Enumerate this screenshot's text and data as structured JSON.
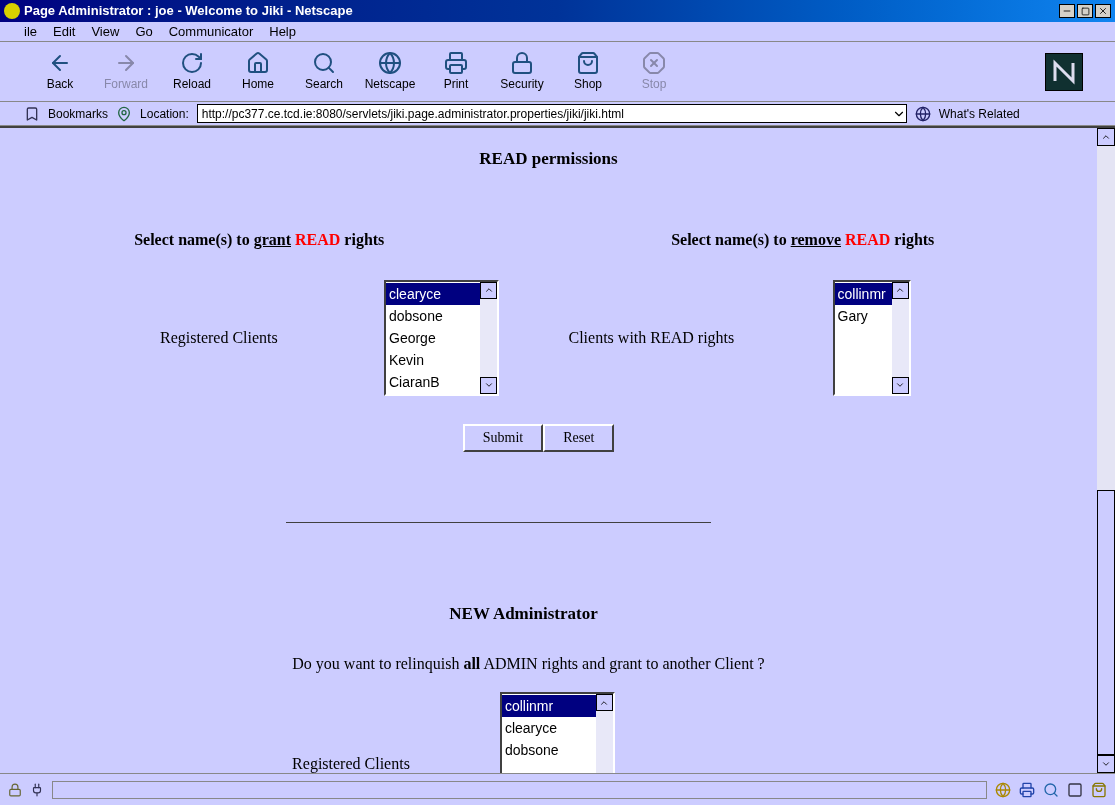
{
  "window": {
    "title": "Page Administrator : joe - Welcome to Jiki - Netscape"
  },
  "menu": [
    "ile",
    "Edit",
    "View",
    "Go",
    "Communicator",
    "Help"
  ],
  "toolbar": [
    {
      "label": "Back",
      "disabled": false
    },
    {
      "label": "Forward",
      "disabled": true
    },
    {
      "label": "Reload",
      "disabled": false
    },
    {
      "label": "Home",
      "disabled": false
    },
    {
      "label": "Search",
      "disabled": false
    },
    {
      "label": "Netscape",
      "disabled": false
    },
    {
      "label": "Print",
      "disabled": false
    },
    {
      "label": "Security",
      "disabled": false
    },
    {
      "label": "Shop",
      "disabled": false
    },
    {
      "label": "Stop",
      "disabled": true
    }
  ],
  "location_bar": {
    "bookmarks": "Bookmarks",
    "location_label": "Location:",
    "url": "http://pc377.ce.tcd.ie:8080/servlets/jiki.page.administrator.properties/jiki/jiki.html",
    "related": "What's Related"
  },
  "read_section": {
    "heading": "READ permissions",
    "grant": {
      "caption": [
        {
          "text": "Select name(s) to ",
          "kind": "plain"
        },
        {
          "text": "grant",
          "kind": "underline"
        },
        {
          "text": " READ",
          "kind": "red"
        },
        {
          "text": " rights",
          "kind": "plain"
        }
      ],
      "label": "Registered Clients",
      "items": [
        {
          "text": "clearyce",
          "selected": true
        },
        {
          "text": "dobsone",
          "selected": false
        },
        {
          "text": "George",
          "selected": false
        },
        {
          "text": "Kevin",
          "selected": false
        },
        {
          "text": "CiaranB",
          "selected": false
        }
      ]
    },
    "remove": {
      "caption": [
        {
          "text": "Select name(s) to ",
          "kind": "plain"
        },
        {
          "text": "remove",
          "kind": "underline"
        },
        {
          "text": " READ",
          "kind": "red"
        },
        {
          "text": " rights",
          "kind": "plain"
        }
      ],
      "label": "Clients with READ rights",
      "items": [
        {
          "text": "collinmr",
          "selected": true
        },
        {
          "text": "Gary",
          "selected": false
        }
      ]
    },
    "buttons": [
      "Submit",
      "Reset"
    ]
  },
  "admin_section": {
    "heading": "NEW Administrator",
    "question": "Do you want to relinquish **all** ADMIN rights and grant to another Client ?",
    "label": "Registered Clients",
    "items": [
      {
        "text": "collinmr",
        "selected": true
      },
      {
        "text": "clearyce",
        "selected": false
      },
      {
        "text": "dobsone",
        "selected": false
      }
    ]
  }
}
